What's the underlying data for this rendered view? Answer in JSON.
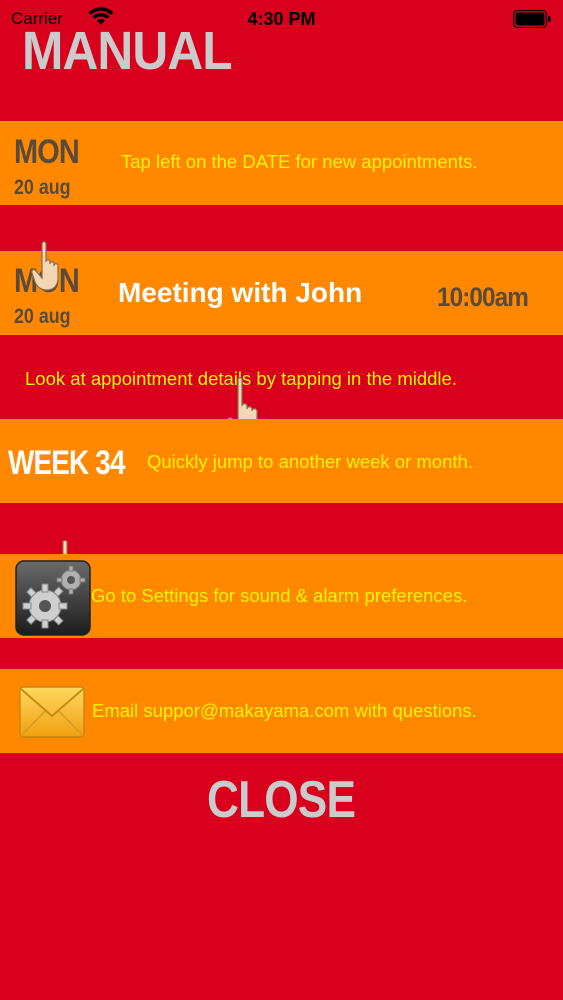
{
  "status_bar": {
    "carrier": "Carrier",
    "time": "4:30 PM"
  },
  "title": "MANUAL",
  "rows": [
    {
      "day": "MON",
      "date": "20 aug",
      "hint": "Tap left on the DATE for new appointments."
    },
    {
      "day": "MON",
      "date": "20 aug",
      "appointment": "Meeting with John",
      "time": "10:00am"
    },
    {
      "hint": "Look at appointment details by tapping in the middle."
    },
    {
      "week": "WEEK 34",
      "hint": "Quickly jump to another week or month."
    },
    {
      "hint": "Go to Settings for sound & alarm preferences."
    },
    {
      "hint": "Email suppor@makayama.com with questions."
    }
  ],
  "close_label": "CLOSE",
  "colors": {
    "background": "#d8001c",
    "band": "#ff8800",
    "hint_text": "#f4f400",
    "title_text": "#cbcbcb",
    "date_text": "#5a4a3a"
  },
  "icons": {
    "signal": "wifi-icon",
    "battery": "battery-icon",
    "hand": "pointing-hand-icon",
    "settings": "gears-icon",
    "email": "envelope-icon"
  }
}
